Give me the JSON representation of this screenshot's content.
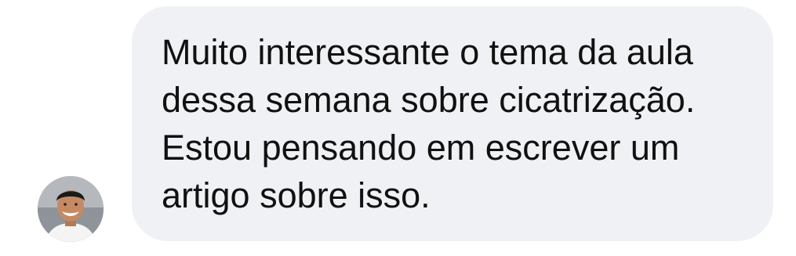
{
  "message": {
    "text": "Muito interessante o tema da aula\ndessa semana sobre cicatrização.\nEstou pensando em escrever um\nartigo sobre isso."
  },
  "avatar": {
    "icon": "person-photo"
  },
  "colors": {
    "bubble_background": "#f0f1f4",
    "text": "#111111",
    "page_background": "#ffffff"
  }
}
